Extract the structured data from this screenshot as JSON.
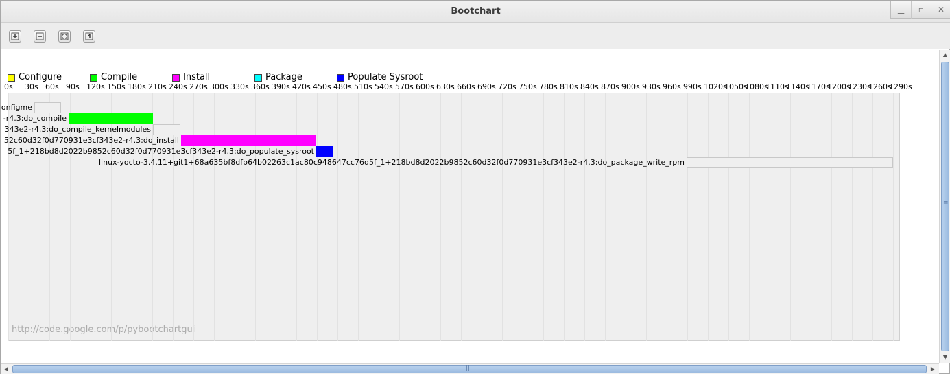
{
  "window": {
    "title": "Bootchart"
  },
  "window_buttons": [
    {
      "name": "minimize-button",
      "glyph": "▁"
    },
    {
      "name": "maximize-button",
      "glyph": "▫"
    },
    {
      "name": "close-button",
      "glyph": "✕"
    }
  ],
  "toolbar": {
    "buttons": [
      {
        "name": "zoom-in-button",
        "icon": "zoom-in-icon"
      },
      {
        "name": "zoom-out-button",
        "icon": "zoom-out-icon"
      },
      {
        "name": "zoom-fit-button",
        "icon": "zoom-fit-icon"
      },
      {
        "name": "zoom-reset-button",
        "icon": "zoom-100-icon"
      }
    ]
  },
  "legend": [
    {
      "label": "Configure",
      "color": "#ffff00"
    },
    {
      "label": "Compile",
      "color": "#00ff00"
    },
    {
      "label": "Install",
      "color": "#ff00ff"
    },
    {
      "label": "Package",
      "color": "#00ffff"
    },
    {
      "label": "Populate Sysroot",
      "color": "#0000ff"
    }
  ],
  "chart_data": {
    "type": "gantt",
    "x_unit": "s",
    "xlim": [
      0,
      1300
    ],
    "x_ticks": [
      "0s",
      "30s",
      "60s",
      "90s",
      "120s",
      "150s",
      "180s",
      "210s",
      "240s",
      "270s",
      "300s",
      "330s",
      "360s",
      "390s",
      "420s",
      "450s",
      "480s",
      "510s",
      "540s",
      "570s",
      "600s",
      "630s",
      "660s",
      "690s",
      "720s",
      "750s",
      "780s",
      "810s",
      "840s",
      "870s",
      "900s",
      "930s",
      "960s",
      "990s",
      "1020s",
      "1050s",
      "1080s",
      "1110s",
      "1140s",
      "1170s",
      "1200s",
      "1230s",
      "1260s",
      "1290s"
    ],
    "tasks": [
      {
        "label": "onfigme",
        "start": 38,
        "end": 77,
        "type": "other",
        "color": "#efefef"
      },
      {
        "label": "-r4.3:do_compile",
        "start": 88,
        "end": 211,
        "type": "Compile",
        "color": "#00ff00"
      },
      {
        "label": "343e2-r4.3:do_compile_kernelmodules",
        "start": 211,
        "end": 251,
        "type": "other",
        "color": "#efefef"
      },
      {
        "label": "52c60d32f0d770931e3cf343e2-r4.3:do_install",
        "start": 252,
        "end": 448,
        "type": "Install",
        "color": "#ff00ff"
      },
      {
        "label": "5f_1+218bd8d2022b9852c60d32f0d770931e3cf343e2-r4.3:do_populate_sysroot",
        "start": 449,
        "end": 474,
        "type": "Populate Sysroot",
        "color": "#0000ff"
      },
      {
        "label": "linux-yocto-3.4.11+git1+68a635bf8dfb64b02263c1ac80c948647cc76d5f_1+218bd8d2022b9852c60d32f0d770931e3cf343e2-r4.3:do_package_write_rpm",
        "start": 989,
        "end": 1290,
        "type": "other",
        "color": "#efefef"
      }
    ]
  },
  "footer": {
    "url": "http://code.google.com/p/pybootchartgui"
  }
}
